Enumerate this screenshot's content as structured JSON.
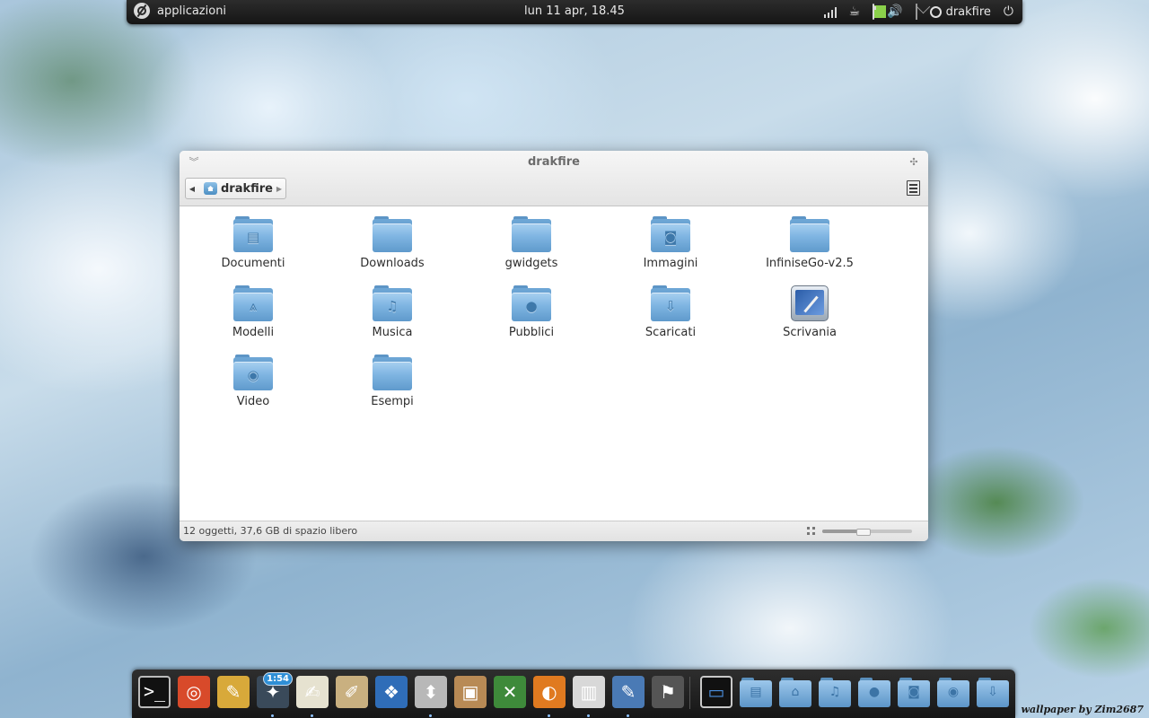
{
  "top_panel": {
    "apps_label": "applicazioni",
    "clock": "lun 11 apr, 18.45",
    "user_name": "drakfire"
  },
  "window": {
    "title": "drakfire",
    "pathbar_label": "drakfire",
    "items": [
      {
        "label": "Documenti",
        "icon": "document-folder-icon",
        "glyph": "▤"
      },
      {
        "label": "Downloads",
        "icon": "folder-icon",
        "glyph": ""
      },
      {
        "label": "gwidgets",
        "icon": "folder-icon",
        "glyph": ""
      },
      {
        "label": "Immagini",
        "icon": "pictures-folder-icon",
        "glyph": "◙"
      },
      {
        "label": "InfiniseGo-v2.5",
        "icon": "folder-icon",
        "glyph": ""
      },
      {
        "label": "Modelli",
        "icon": "templates-folder-icon",
        "glyph": "⩓"
      },
      {
        "label": "Musica",
        "icon": "music-folder-icon",
        "glyph": "♫"
      },
      {
        "label": "Pubblici",
        "icon": "public-folder-icon",
        "glyph": "●"
      },
      {
        "label": "Scaricati",
        "icon": "download-folder-icon",
        "glyph": "⇩"
      },
      {
        "label": "Scrivania",
        "icon": "desktop-icon",
        "glyph": ""
      },
      {
        "label": "Video",
        "icon": "video-folder-icon",
        "glyph": "◉"
      },
      {
        "label": "Esempi",
        "icon": "folder-icon",
        "glyph": ""
      }
    ],
    "status_text": "12 oggetti, 37,6 GB di spazio libero",
    "zoom_level": 0.45
  },
  "dock": {
    "apps": [
      {
        "name": "terminal-icon",
        "glyph": ">_",
        "color": "#111111",
        "running": false
      },
      {
        "name": "disc-burner-icon",
        "glyph": "◎",
        "color": "#d84a2a",
        "running": false
      },
      {
        "name": "paint-icon",
        "glyph": "✎",
        "color": "#d8a93a",
        "running": false
      },
      {
        "name": "clock-app-icon",
        "glyph": "✦",
        "color": "#3a4a5a",
        "running": true,
        "badge": "1:54"
      },
      {
        "name": "text-editor-icon",
        "glyph": "✍",
        "color": "#e6e2d0",
        "running": true
      },
      {
        "name": "drawing-icon",
        "glyph": "✐",
        "color": "#c9b080",
        "running": false
      },
      {
        "name": "presentation-icon",
        "glyph": "❖",
        "color": "#2f6db8",
        "running": false
      },
      {
        "name": "system-updater-icon",
        "glyph": "⬍",
        "color": "#b8b8b8",
        "running": true
      },
      {
        "name": "archive-manager-icon",
        "glyph": "▣",
        "color": "#b88a55",
        "running": false
      },
      {
        "name": "xchat-icon",
        "glyph": "✕",
        "color": "#3e8a3a",
        "running": false
      },
      {
        "name": "firefox-icon",
        "glyph": "◐",
        "color": "#e07a20",
        "running": true
      },
      {
        "name": "file-manager-icon",
        "glyph": "▥",
        "color": "#d8d8d8",
        "running": true
      },
      {
        "name": "settings-icon",
        "glyph": "✎",
        "color": "#4a7ab5",
        "running": true
      },
      {
        "name": "system-monitor-icon",
        "glyph": "⚑",
        "color": "#555555",
        "running": false
      }
    ],
    "places": [
      {
        "name": "desktop-place-icon",
        "glyph": "▭",
        "color": "#1e5fb0"
      },
      {
        "name": "documents-place-icon",
        "glyph": "▤"
      },
      {
        "name": "home-place-icon",
        "glyph": "⌂"
      },
      {
        "name": "music-place-icon",
        "glyph": "♫"
      },
      {
        "name": "public-place-icon",
        "glyph": "●"
      },
      {
        "name": "pictures-place-icon",
        "glyph": "◙"
      },
      {
        "name": "videos-place-icon",
        "glyph": "◉"
      },
      {
        "name": "downloads-place-icon",
        "glyph": "⇩"
      }
    ]
  },
  "wallpaper_credit": "wallpaper by Zim2687"
}
